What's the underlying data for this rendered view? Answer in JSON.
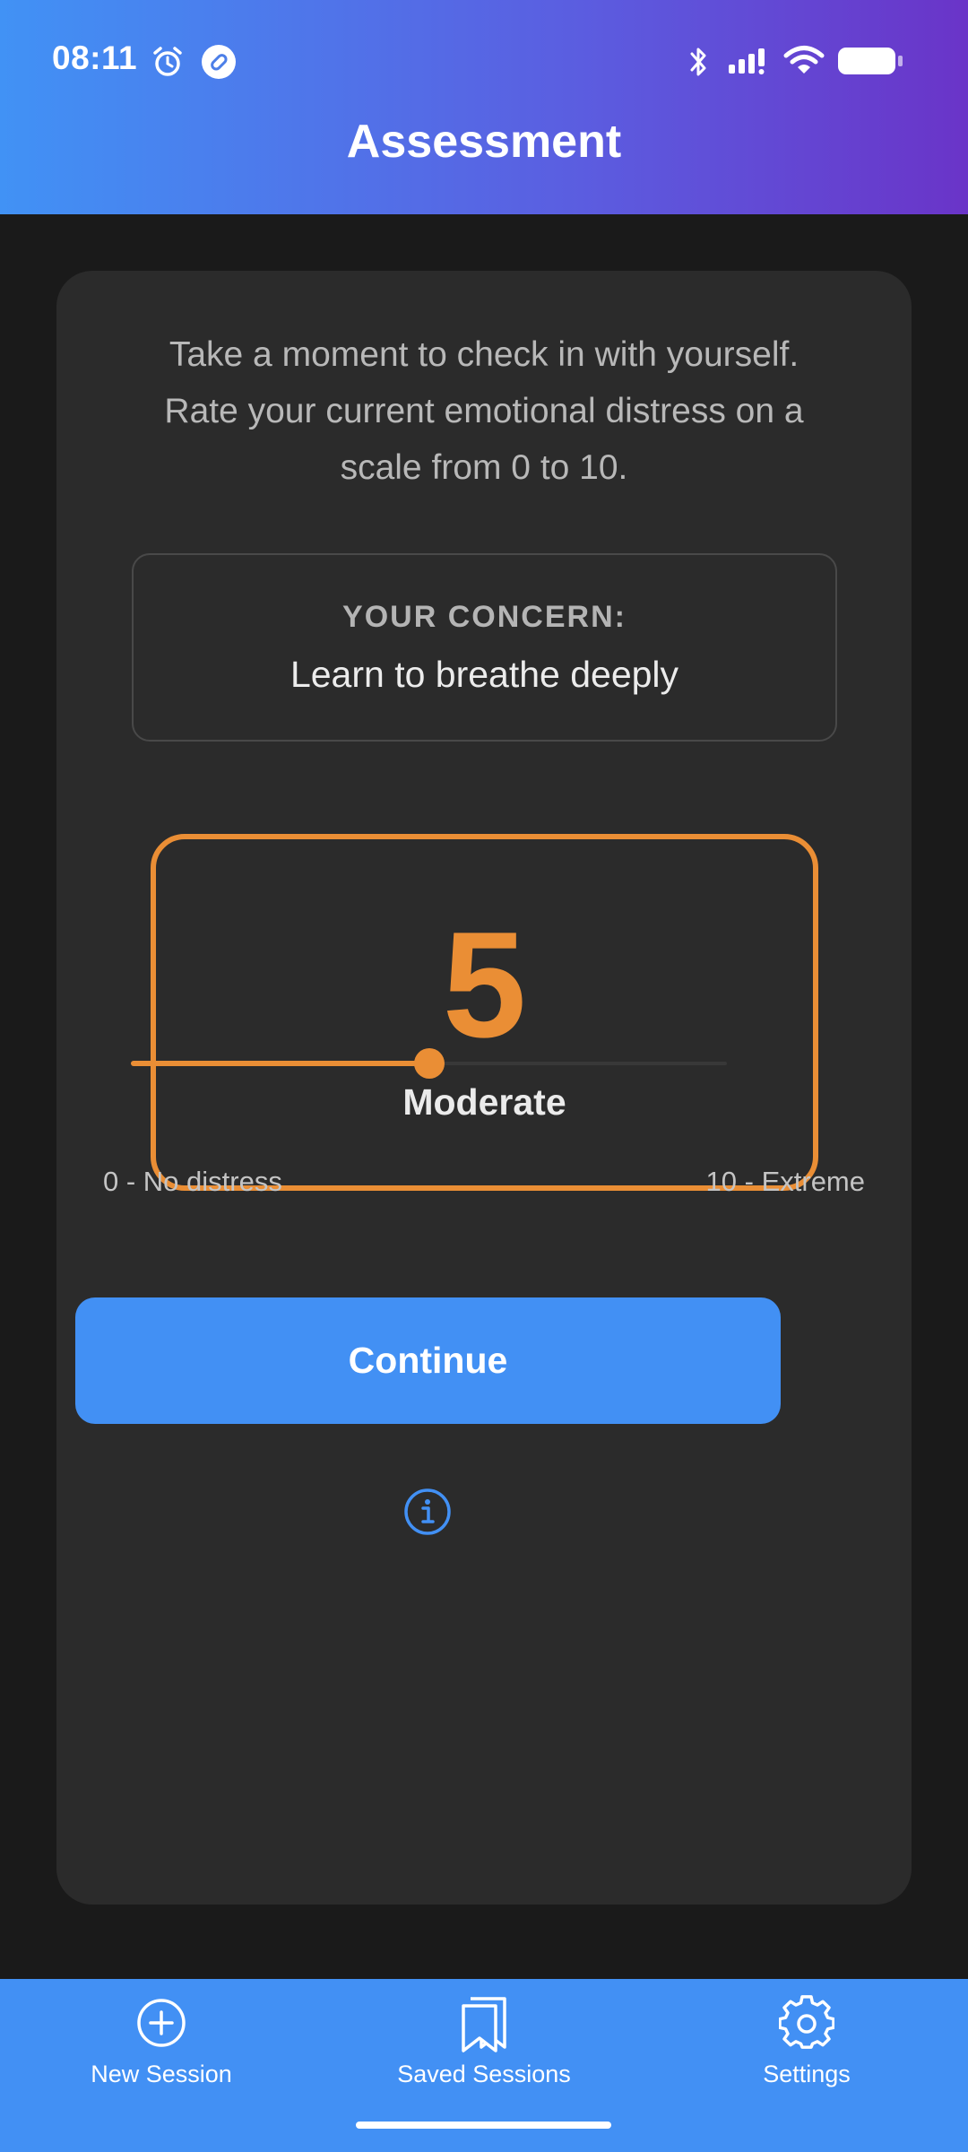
{
  "status_bar": {
    "time": "08:11",
    "icons": [
      "alarm-icon",
      "app-notification-icon",
      "bluetooth-icon",
      "signal-icon",
      "wifi-icon",
      "battery-icon"
    ]
  },
  "header": {
    "title": "Assessment"
  },
  "card": {
    "intro": "Take a moment to check in with yourself. Rate your current emotional distress on a scale from 0 to 10.",
    "concern_label": "YOUR CONCERN:",
    "concern_value": "Learn to breathe deeply",
    "score": {
      "value": "5",
      "label": "Moderate",
      "color": "#ea8e35"
    },
    "slider": {
      "min": 0,
      "max": 10,
      "value": 5
    },
    "scale_min_label": "0 - No distress",
    "scale_max_label": "10 - Extreme",
    "continue_label": "Continue",
    "info_icon": "info-icon"
  },
  "bottom_nav": {
    "items": [
      {
        "label": "New Session",
        "icon": "plus-circle-icon"
      },
      {
        "label": "Saved Sessions",
        "icon": "bookmark-icon"
      },
      {
        "label": "Settings",
        "icon": "gear-icon"
      }
    ]
  },
  "colors": {
    "accent": "#4290f4",
    "score": "#ea8e35",
    "background": "#1a1a1a",
    "card": "#2b2b2b"
  }
}
